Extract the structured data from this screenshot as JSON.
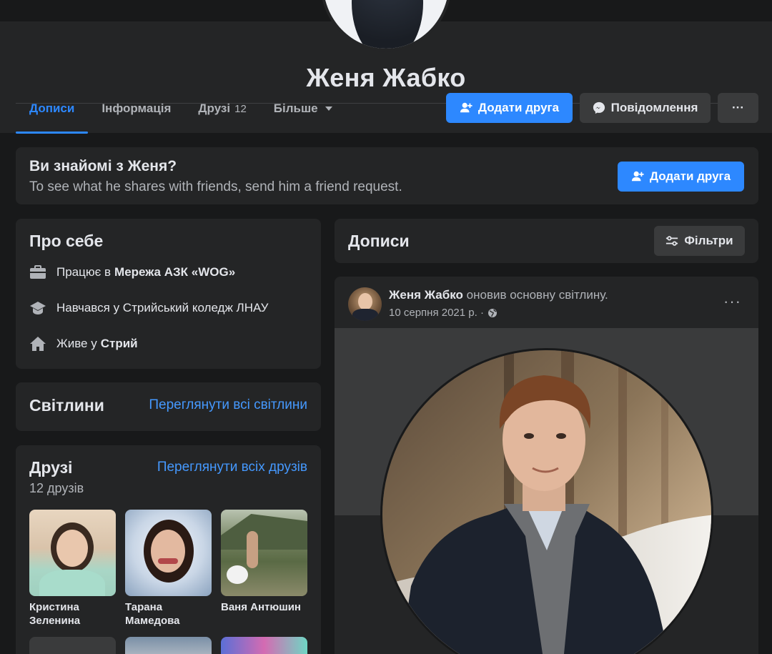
{
  "profile": {
    "name": "Женя Жабко"
  },
  "tabs": [
    {
      "label": "Дописи",
      "active": true
    },
    {
      "label": "Інформація"
    },
    {
      "label": "Друзі",
      "count": "12"
    },
    {
      "label": "Більше"
    }
  ],
  "actions": {
    "add_friend": "Додати друга",
    "message": "Повідомлення",
    "more": "···"
  },
  "know_card": {
    "title": "Ви знайомі з Женя?",
    "subtitle": "To see what he shares with friends, send him a friend request.",
    "button": "Додати друга"
  },
  "about": {
    "title": "Про себе",
    "items": [
      {
        "icon": "briefcase-icon",
        "text": "Працює в",
        "bold": "Мережа АЗК «WOG»"
      },
      {
        "icon": "graduation-cap-icon",
        "text": "Навчався у Стрийський коледж ЛНАУ",
        "bold": ""
      },
      {
        "icon": "home-icon",
        "text": "Живе у",
        "bold": "Стрий"
      }
    ]
  },
  "photos": {
    "title": "Світлини",
    "link": "Переглянути всі світлини"
  },
  "friends": {
    "title": "Друзі",
    "count": "12 друзів",
    "link": "Переглянути всіх друзів",
    "list": [
      {
        "name": "Кристина Зеленина"
      },
      {
        "name": "Тарана Мамедова"
      },
      {
        "name": "Ваня Антюшин"
      }
    ]
  },
  "posts": {
    "title": "Дописи",
    "filter": "Фільтри",
    "post": {
      "author": "Женя Жабко",
      "action": "оновив основну світлину.",
      "date": "10 серпня 2021 р. ·",
      "dots": "···"
    }
  },
  "colors": {
    "accent": "#2d88ff",
    "background": "#18191a",
    "card": "#242526"
  }
}
